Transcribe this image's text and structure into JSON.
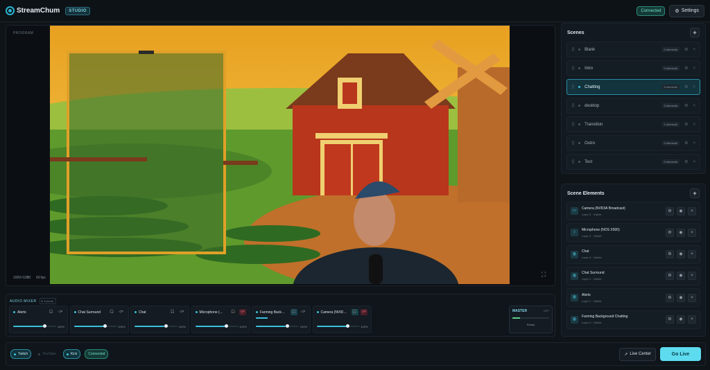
{
  "app": {
    "name": "StreamChum",
    "badge": "STUDIO"
  },
  "header": {
    "status": "Connected",
    "settings_label": "Settings"
  },
  "program": {
    "label": "PROGRAM",
    "resolution": "1920×1080",
    "fps": "60 fps"
  },
  "scenes": {
    "title": "Scenes",
    "items": [
      {
        "name": "Blank",
        "count": "0 elements"
      },
      {
        "name": "Intro",
        "count": "0 elements"
      },
      {
        "name": "Chatting",
        "count": "6 elements",
        "selected": true
      },
      {
        "name": "desktop",
        "count": "3 elements"
      },
      {
        "name": "Transition",
        "count": "1 elements"
      },
      {
        "name": "Outro",
        "count": "2 elements"
      },
      {
        "name": "Test",
        "count": "0 elements"
      }
    ]
  },
  "elements": {
    "title": "Scene Elements",
    "items": [
      {
        "name": "Camera (NVIDIA Broadcast)",
        "sub": "Layer 5 · Visible",
        "icon": "camera-icon"
      },
      {
        "name": "Microphone (NOS X500)",
        "sub": "Layer 4 · Visible",
        "icon": "microphone-icon"
      },
      {
        "name": "Chat",
        "sub": "Layer 3 · Visible",
        "icon": "globe-icon"
      },
      {
        "name": "Chat Surround",
        "sub": "Layer 2 · Visible",
        "icon": "globe-icon"
      },
      {
        "name": "Alerts",
        "sub": "Layer 1 · Visible",
        "icon": "globe-icon"
      },
      {
        "name": "Farming Background Chatting",
        "sub": "Layer 0 · Visible",
        "icon": "globe-icon"
      }
    ]
  },
  "mixer": {
    "title": "AUDIO MIXER",
    "tracks": "6 tracks",
    "channels": [
      {
        "name": "Alerts",
        "pct": "100%",
        "level": 0.7,
        "headphones": "off",
        "muted": false
      },
      {
        "name": "Chat Surround",
        "pct": "100%",
        "level": 0.7,
        "headphones": "off",
        "muted": false
      },
      {
        "name": "Chat",
        "pct": "100%",
        "level": 0.7,
        "headphones": "off",
        "muted": false
      },
      {
        "name": "Microphone (…",
        "pct": "100%",
        "level": 0.7,
        "headphones": "off",
        "muted": true
      },
      {
        "name": "Farming Back…",
        "pct": "100%",
        "level": 0.7,
        "headphones": "on",
        "muted": false,
        "meter": 0.22
      },
      {
        "name": "Camera (NVID…",
        "pct": "100%",
        "level": 0.7,
        "headphones": "on",
        "muted": true
      }
    ],
    "master": {
      "label": "MASTER",
      "state": "OFF",
      "status": "Ready",
      "level": 0.2
    }
  },
  "footer": {
    "platforms": [
      {
        "name": "Twitch",
        "on": true
      },
      {
        "name": "YouTube",
        "on": false
      },
      {
        "name": "Kick",
        "on": true
      }
    ],
    "status": "Connected",
    "live_center": "Live Center",
    "go_live": "Go Live"
  },
  "colors": {
    "accent": "#3ac0dc",
    "bg": "#0f1419",
    "go_live": "#5ddcf0"
  }
}
